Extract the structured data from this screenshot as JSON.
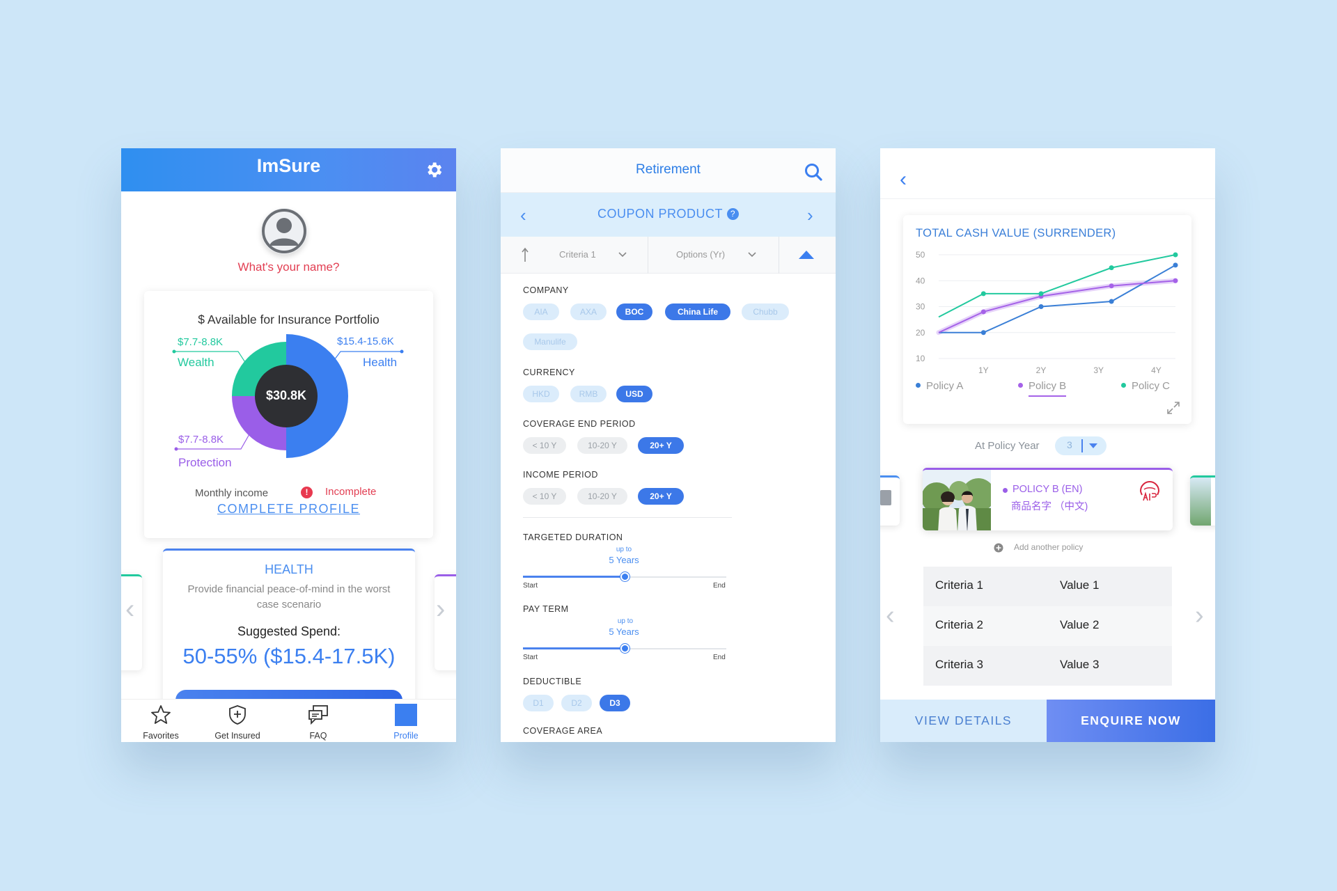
{
  "phone1": {
    "app_title": "ImSure",
    "name_prompt": "What's your name?",
    "available_title": "$ Available for Insurance Portfolio",
    "total": "$30.8K",
    "segments": [
      {
        "name": "Wealth",
        "range": "$7.7-8.8K",
        "share": 0.25,
        "color": "#22c99e"
      },
      {
        "name": "Health",
        "range": "$15.4-15.6K",
        "share": 0.5,
        "color": "#3b7ff0"
      },
      {
        "name": "Protection",
        "range": "$7.7-8.8K",
        "share": 0.25,
        "color": "#9a5ee8"
      }
    ],
    "monthly_label": "Monthly income",
    "incomplete_icon": "!",
    "incomplete_label": "Incomplete",
    "complete_profile": "COMPLETE PROFILE",
    "health_card": {
      "title": "HEALTH",
      "desc": "Provide financial peace-of-mind in the worst case scenario",
      "suggested_label": "Suggested Spend:",
      "suggested_value": "50-55% ($15.4-17.5K)"
    },
    "tabs": [
      {
        "label": "Favorites",
        "icon": "star-icon",
        "active": false
      },
      {
        "label": "Get Insured",
        "icon": "shield-icon",
        "active": false
      },
      {
        "label": "FAQ",
        "icon": "chat-icon",
        "active": false
      },
      {
        "label": "Profile",
        "icon": "profile-square-icon",
        "active": true
      }
    ],
    "accent": "#3b7ff0"
  },
  "phone2": {
    "title": "Retirement",
    "coupon_title": "COUPON PRODUCT",
    "help_icon": "?",
    "filter": {
      "criteria": "Criteria 1",
      "options": "Options (Yr)"
    },
    "company": {
      "label": "COMPANY",
      "chips": [
        {
          "text": "AIA",
          "on": false
        },
        {
          "text": "AXA",
          "on": false
        },
        {
          "text": "BOC",
          "on": true
        },
        {
          "text": "China Life",
          "on": true
        },
        {
          "text": "Chubb",
          "on": false
        },
        {
          "text": "Manulife",
          "on": false
        }
      ]
    },
    "currency": {
      "label": "CURRENCY",
      "chips": [
        {
          "text": "HKD",
          "on": false
        },
        {
          "text": "RMB",
          "on": false
        },
        {
          "text": "USD",
          "on": true
        }
      ]
    },
    "coverage_end": {
      "label": "COVERAGE END PERIOD",
      "chips": [
        {
          "text": "< 10 Y",
          "on": false
        },
        {
          "text": "10-20 Y",
          "on": false
        },
        {
          "text": "20+ Y",
          "on": true
        }
      ]
    },
    "income_period": {
      "label": "INCOME PERIOD",
      "chips": [
        {
          "text": "< 10 Y",
          "on": false
        },
        {
          "text": "10-20 Y",
          "on": false
        },
        {
          "text": "20+ Y",
          "on": true
        }
      ]
    },
    "targeted_duration": {
      "label": "TARGETED DURATION",
      "caption": "up to",
      "value": "5 Years",
      "start": "Start",
      "end": "End",
      "level": 0.5
    },
    "pay_term": {
      "label": "PAY TERM",
      "caption": "up to",
      "value": "5 Years",
      "start": "Start",
      "end": "End",
      "level": 0.5
    },
    "deductible": {
      "label": "DEDUCTIBLE",
      "chips": [
        {
          "text": "D1",
          "on": false
        },
        {
          "text": "D2",
          "on": false
        },
        {
          "text": "D3",
          "on": true
        }
      ]
    },
    "coverage_area": {
      "label": "COVERAGE AREA"
    }
  },
  "phone3": {
    "chart_data": {
      "type": "line",
      "title": "TOTAL CASH VALUE (SURRENDER)",
      "x": [
        "",
        "1Y",
        "",
        "2Y",
        "",
        "3Y",
        "",
        "4Y"
      ],
      "x_ticks": [
        "1Y",
        "2Y",
        "3Y",
        "4Y"
      ],
      "y_ticks": [
        10,
        20,
        30,
        40,
        50
      ],
      "ylim": [
        10,
        50
      ],
      "xlim": [
        0,
        3.7
      ],
      "series": [
        {
          "name": "Policy A",
          "color": "#3a7fd6",
          "points": [
            [
              0,
              20
            ],
            [
              0.7,
              20
            ],
            [
              1.6,
              30
            ],
            [
              2.7,
              32
            ],
            [
              3.7,
              46
            ]
          ]
        },
        {
          "name": "Policy B",
          "color": "#a562e8",
          "points": [
            [
              0,
              20
            ],
            [
              0.7,
              28
            ],
            [
              1.6,
              34
            ],
            [
              2.7,
              38
            ],
            [
              3.7,
              40
            ]
          ]
        },
        {
          "name": "Policy C",
          "color": "#22c99e",
          "points": [
            [
              0,
              26
            ],
            [
              0.7,
              35
            ],
            [
              1.6,
              35
            ],
            [
              2.7,
              45
            ],
            [
              3.7,
              50
            ]
          ]
        }
      ],
      "active_legend": "Policy B",
      "grid": true
    },
    "policy_year_label": "At Policy Year",
    "policy_year_value": "3",
    "policy_name": "POLICY B (EN)",
    "policy_name_cn": "商品名字 （中文)",
    "add_policy": "Add another policy",
    "criteria": [
      {
        "k": "Criteria 1",
        "v": "Value 1"
      },
      {
        "k": "Criteria 2",
        "v": "Value 2"
      },
      {
        "k": "Criteria 3",
        "v": "Value 3"
      }
    ],
    "view_details": "VIEW DETAILS",
    "enquire_now": "ENQUIRE NOW"
  }
}
